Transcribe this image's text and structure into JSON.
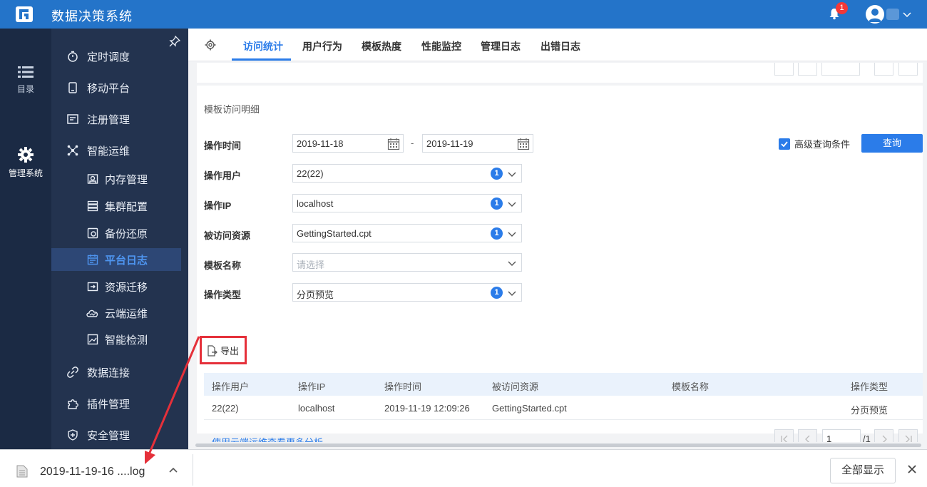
{
  "app": {
    "title": "数据决策系统",
    "notification_count": "1"
  },
  "rail": {
    "items": [
      {
        "label": "目录"
      },
      {
        "label": "管理系统"
      }
    ]
  },
  "nav": {
    "items": [
      {
        "label": "定时调度"
      },
      {
        "label": "移动平台"
      },
      {
        "label": "注册管理"
      },
      {
        "label": "智能运维"
      },
      {
        "label": "内存管理"
      },
      {
        "label": "集群配置"
      },
      {
        "label": "备份还原"
      },
      {
        "label": "平台日志"
      },
      {
        "label": "资源迁移"
      },
      {
        "label": "云端运维"
      },
      {
        "label": "智能检测"
      },
      {
        "label": "数据连接"
      },
      {
        "label": "插件管理"
      },
      {
        "label": "安全管理"
      }
    ]
  },
  "tabs": [
    {
      "label": "访问统计"
    },
    {
      "label": "用户行为"
    },
    {
      "label": "模板热度"
    },
    {
      "label": "性能监控"
    },
    {
      "label": "管理日志"
    },
    {
      "label": "出错日志"
    }
  ],
  "card": {
    "title": "模板访问明细"
  },
  "filters": {
    "time_label": "操作时间",
    "date_start": "2019-11-18",
    "date_sep": "-",
    "date_end": "2019-11-19",
    "user_label": "操作用户",
    "user_value": "22(22)",
    "user_count": "1",
    "ip_label": "操作IP",
    "ip_value": "localhost",
    "ip_count": "1",
    "resource_label": "被访问资源",
    "resource_value": "GettingStarted.cpt",
    "resource_count": "1",
    "template_label": "模板名称",
    "template_placeholder": "请选择",
    "type_label": "操作类型",
    "type_value": "分页预览",
    "type_count": "1"
  },
  "advanced": {
    "label": "高级查询条件",
    "checked": true
  },
  "query_button": "查询",
  "export_button": "导出",
  "table": {
    "headers": [
      "操作用户",
      "操作IP",
      "操作时间",
      "被访问资源",
      "模板名称",
      "操作类型"
    ],
    "rows": [
      [
        "22(22)",
        "localhost",
        "2019-11-19 12:09:26",
        "GettingStarted.cpt",
        "",
        "分页预览"
      ]
    ]
  },
  "more_link": "使用云端运维查看更多分析",
  "pagination": {
    "current": "1",
    "total": "/1"
  },
  "download": {
    "filename": "2019-11-19-16 ....log",
    "show_all": "全部显示"
  },
  "colors": {
    "topbar": "#2474c9",
    "accent": "#2b7ce9",
    "nav_bg": "#23334f",
    "rail_bg": "#1b2a44",
    "highlight": "#e5303a"
  }
}
